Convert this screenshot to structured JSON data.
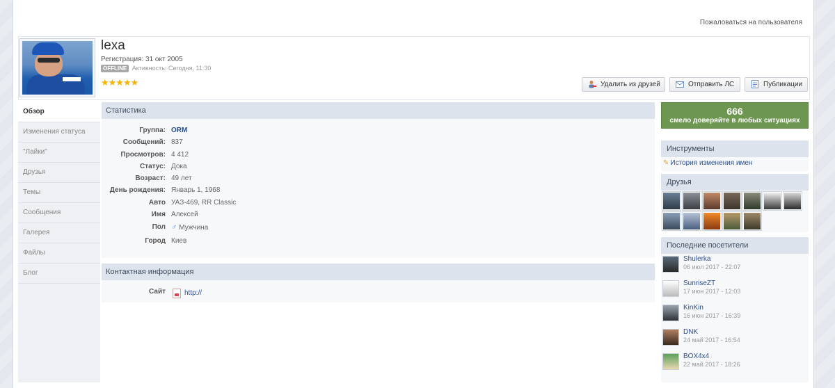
{
  "page": {
    "report_link": "Пожаловаться на пользователя"
  },
  "profile": {
    "username": "lexa",
    "registration": "Регистрация: 31 окт 2005",
    "offline_badge": "OFFLINE",
    "activity": "Активность: Сегодня, 11:30",
    "stars": "★★★★★",
    "buttons": {
      "unfriend": "Удалить из друзей",
      "send_pm": "Отправить ЛС",
      "posts": "Публикации"
    }
  },
  "sidebar": {
    "items": [
      {
        "label": "Обзор"
      },
      {
        "label": "Изменения статуса"
      },
      {
        "label": "\"Лайки\""
      },
      {
        "label": "Друзья"
      },
      {
        "label": "Темы"
      },
      {
        "label": "Сообщения"
      },
      {
        "label": "Галерея"
      },
      {
        "label": "Файлы"
      },
      {
        "label": "Блог"
      }
    ]
  },
  "stats": {
    "title": "Статистика",
    "rows": [
      {
        "label": "Группа:",
        "value": "ORM"
      },
      {
        "label": "Сообщений:",
        "value": "837"
      },
      {
        "label": "Просмотров:",
        "value": "4 412"
      },
      {
        "label": "Статус:",
        "value": "Дока"
      },
      {
        "label": "Возраст:",
        "value": "49 лет"
      },
      {
        "label": "День рождения:",
        "value": "Январь 1, 1968"
      },
      {
        "label": "Авто",
        "value": "УАЗ-469, RR Classic"
      },
      {
        "label": "Имя",
        "value": "Алексей"
      },
      {
        "label": "Пол",
        "value": "Мужчина"
      },
      {
        "label": "Город",
        "value": "Киев"
      }
    ]
  },
  "contact": {
    "title": "Контактная информация",
    "site_label": "Сайт",
    "site_value": "http://"
  },
  "reputation": {
    "value": "666",
    "text": "смело доверяйте в любых ситуациях",
    "color": "#6d9651"
  },
  "tools": {
    "title": "Инструменты",
    "name_history": "История изменения имен"
  },
  "friends": {
    "title": "Друзья"
  },
  "visitors": {
    "title": "Последние посетители",
    "items": [
      {
        "name": "Shulerka",
        "date": "06 июл 2017 - 22:07"
      },
      {
        "name": "SunriseZT",
        "date": "17 июн 2017 - 12:03"
      },
      {
        "name": "KinKin",
        "date": "16 июн 2017 - 16:39"
      },
      {
        "name": "DNK",
        "date": "24 май 2017 - 16:54"
      },
      {
        "name": "BOX4x4",
        "date": "22 май 2017 - 18:26"
      }
    ]
  }
}
